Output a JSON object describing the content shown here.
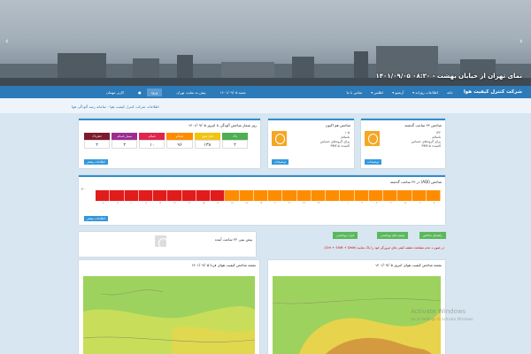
{
  "hero": {
    "caption": "نمای تهران از خیابان بهشت - ۰۸:۳۰ ۱۴۰۱/۰۹/۰۵",
    "prev_icon": "chevron-left-icon",
    "next_icon": "chevron-right-icon"
  },
  "navbar": {
    "brand": "شرکت کنترل کیفیت هوا",
    "links": [
      "خانه",
      "اطلاعات روزانه ▾",
      "آرشیو ▾",
      "اطلس ▾",
      "تماس با ما"
    ],
    "date": "شنبه ۱۴۰۱/۰۹/۰۵",
    "site_link": "پیش به سایت تهران",
    "login": "ورود",
    "user": "کاربر مهمان"
  },
  "breadcrumb": "اطلاعات شرکت کنترل کیفیت هوا - سامانه رصد آلودگی هوا",
  "panel_24h": {
    "title": "شاخص ۲۴ ساعت گذشته",
    "value": "۱۳۲",
    "lines": [
      "۱۳۲",
      "ناسالم",
      "برای گروه‌های حساس",
      "آلاینده: PM۲.۵"
    ],
    "button": "توضیحات"
  },
  "panel_now": {
    "title": "شاخص هم اکنون",
    "lines": [
      "۱۰۵",
      "ناسالم",
      "برای گروه‌های حساس",
      "آلاینده: PM۲.۵"
    ],
    "button": "توضیحات"
  },
  "panel_days": {
    "title": "روز شمار شاخص آلودگی تا امروز ۱۴۰۱/۰۹/۰۵",
    "headers": [
      "پاک",
      "قابل قبول",
      "ناسالم",
      "بسیار ناسالم",
      "خطرناک"
    ],
    "values": [
      "۲",
      "۱۳۸",
      "۹۶",
      "۱۰",
      "۲",
      "۲"
    ],
    "colors": [
      "#4caf50",
      "#f1c40f",
      "#ff8c00",
      "#e0244e",
      "#9b2d8f",
      "#7e1a2a"
    ],
    "button": "اطلاعات بیشتر"
  },
  "panel_aqi": {
    "title": "شاخص (AQI) در ۲۴ ساعت گذشته",
    "ylabel": "۳۰۰",
    "bar_colors": [
      "#e21b1b",
      "#e21b1b",
      "#e21b1b",
      "#e21b1b",
      "#e21b1b",
      "#e21b1b",
      "#e21b1b",
      "#e21b1b",
      "#e21b1b",
      "#ff8c00",
      "#ff8c00",
      "#ff8c00",
      "#ff8c00",
      "#ff8c00",
      "#ff8c00",
      "#ff8c00",
      "#ff8c00",
      "#ff8c00",
      "#ff8c00",
      "#ff8c00",
      "#ff8c00",
      "#ff8c00",
      "#ff8c00",
      "#ff8c00"
    ],
    "ticks": [
      "۰۸",
      "۰۹",
      "۱۰",
      "۱۱",
      "۱۲",
      "۱۳",
      "۱۴",
      "۱۵",
      "۱۶",
      "۱۷",
      "۱۸",
      "۱۹",
      "۲۰",
      "۲۱",
      "۲۲",
      "۲۳",
      "۰۰",
      "۰۱",
      "۰۲",
      "۰۳",
      "۰۴",
      "۰۵",
      "۰۶",
      "۰۷"
    ],
    "button": "اطلاعات بیشتر"
  },
  "forecast": {
    "title": "پیش بینی ۲۴ ساعت آینده"
  },
  "tabs": [
    "راهنمای شاخص",
    "توصیه های بهداشتی",
    "اثرات بهداشتی"
  ],
  "warning": "در صورت عدم مشاهده نقشه کیفی های مرورگر خود را پاک نمایید (Ctrl + Shift + Dele)",
  "map_left": {
    "title": "نقشه شاخص کیفیت هوای فردا ۱۴۰۱/۰۹/۰۵"
  },
  "map_right": {
    "title": "نقشه شاخص کیفیت هوای امروز ۱۴۰۱/۰۹/۰۵"
  },
  "os": {
    "watermark": "Activate Windows",
    "watermark_sub": "Go to Settings to activate Windows."
  }
}
